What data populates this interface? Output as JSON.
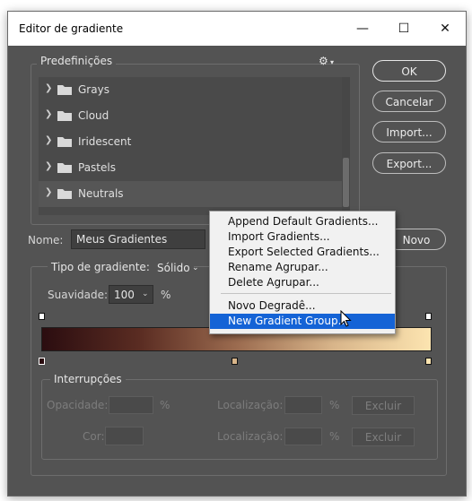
{
  "window": {
    "title": "Editor de gradiente",
    "minimize_glyph": "—",
    "maximize_glyph": "☐",
    "close_glyph": "✕"
  },
  "buttons": {
    "ok": "OK",
    "cancel": "Cancelar",
    "import": "Import...",
    "export": "Export...",
    "new": "Novo"
  },
  "presets": {
    "legend": "Predefinições",
    "gear_glyph": "⚙",
    "items": [
      {
        "label": "Grays"
      },
      {
        "label": "Cloud"
      },
      {
        "label": "Iridescent"
      },
      {
        "label": "Pastels"
      },
      {
        "label": "Neutrals"
      }
    ]
  },
  "name_field": {
    "label": "Nome:",
    "value": "Meus Gradientes"
  },
  "gradient_type": {
    "label": "Tipo de gradiente:",
    "value": "Sólido"
  },
  "smoothness": {
    "label": "Suavidade:",
    "value": "100",
    "unit": "%"
  },
  "gradient": {
    "colors": [
      "#2b0d10",
      "#5a2c22",
      "#9b6b4f",
      "#d8b58a",
      "#fce4b0"
    ]
  },
  "stops_panel": {
    "legend": "Interrupções",
    "opacity_label": "Opacidade:",
    "opacity_unit": "%",
    "color_label": "Cor:",
    "location_label": "Localização:",
    "location_unit": "%",
    "delete_label": "Excluir"
  },
  "context_menu": {
    "items": [
      "Append Default Gradients...",
      "Import Gradients...",
      "Export Selected Gradients...",
      "Rename Agrupar...",
      "Delete Agrupar..."
    ],
    "items2": [
      "Novo Degradê...",
      "New Gradient Group..."
    ],
    "highlighted": "New Gradient Group..."
  }
}
